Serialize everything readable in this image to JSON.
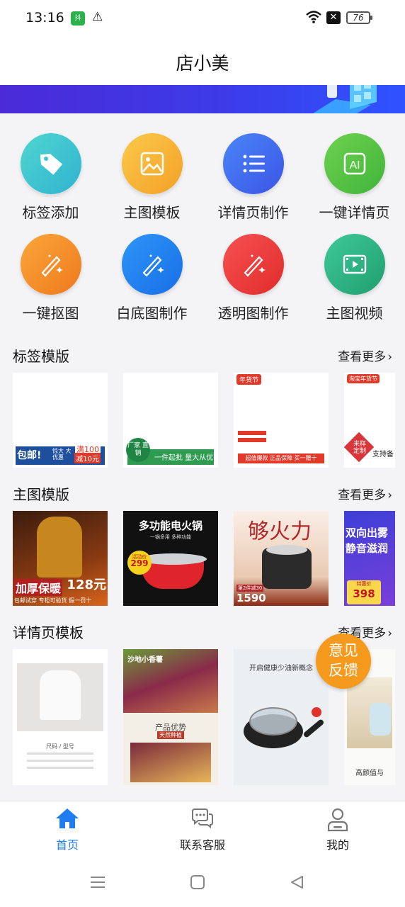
{
  "status_bar": {
    "time": "13:16",
    "app_icon_text": "抖\n推",
    "battery": "76"
  },
  "header": {
    "title": "店小美"
  },
  "tools": [
    {
      "label": "标签添加",
      "icon": "tag-icon",
      "color": "#3ec5c9"
    },
    {
      "label": "主图模板",
      "icon": "image-icon",
      "color": "#f6b530"
    },
    {
      "label": "详情页制作",
      "icon": "list-icon",
      "color": "#3b6bf2"
    },
    {
      "label": "一键详情页",
      "icon": "ai-icon",
      "color": "#54c243"
    },
    {
      "label": "一键抠图",
      "icon": "magic-wand-icon",
      "color": "#f28a24"
    },
    {
      "label": "白底图制作",
      "icon": "magic-wand-icon",
      "color": "#1f7df0"
    },
    {
      "label": "透明图制作",
      "icon": "magic-wand-icon",
      "color": "#ef3a3a"
    },
    {
      "label": "主图视频",
      "icon": "film-icon",
      "color": "#29b381"
    }
  ],
  "sections": {
    "label_templates": {
      "title": "标签模版",
      "more": "查看更多"
    },
    "main_templates": {
      "title": "主图模版",
      "more": "查看更多"
    },
    "detail_templates": {
      "title": "详情页模板",
      "more": "查看更多"
    }
  },
  "label_thumbs": [
    {
      "texts": [
        "包邮!",
        "惊大 大优惠",
        "满100",
        "减10元",
        "GIFTS WAITING FOR YOU"
      ]
    },
    {
      "texts": [
        "厂家 直销",
        "一件起批 量大从优"
      ]
    },
    {
      "texts": [
        "年货节",
        "超值爆款 正品保障 买一赠十"
      ]
    },
    {
      "texts": [
        "淘宝年货节",
        "来样 定制",
        "支持备"
      ]
    }
  ],
  "main_thumbs": [
    {
      "texts": [
        "加厚保暖",
        "128元",
        "包邮试穿 专柜可验货 假一罚十"
      ]
    },
    {
      "texts": [
        "多功能电火锅",
        "一锅多用 多种功能",
        "活动价",
        "299"
      ]
    },
    {
      "texts": [
        "够火力",
        "第2件减30",
        "1590"
      ]
    },
    {
      "texts": [
        "双向出雾",
        "静音滋润",
        "特惠价",
        "398"
      ]
    }
  ],
  "detail_thumbs": [
    {
      "texts": [
        "尺码 / 型号"
      ]
    },
    {
      "texts": [
        "沙地小香薯",
        "产品优势",
        "天然种植"
      ]
    },
    {
      "texts": [
        "开启健康少油新概念"
      ]
    },
    {
      "texts": [
        "高颜值与"
      ]
    }
  ],
  "feedback": {
    "line1": "意见",
    "line2": "反馈"
  },
  "tabbar": {
    "home": "首页",
    "service": "联系客服",
    "mine": "我的",
    "active_color": "#1f7df0"
  }
}
